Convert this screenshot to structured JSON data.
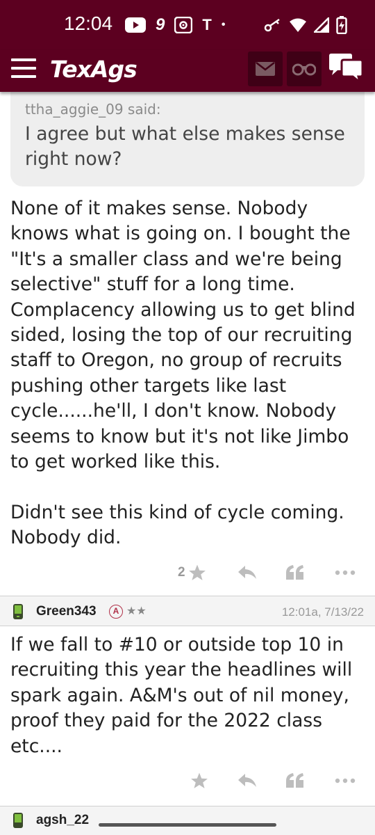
{
  "status_bar": {
    "time": "12:04",
    "icons": [
      "youtube-icon",
      "nine-icon",
      "radio-icon",
      "t-icon",
      "dot-icon"
    ],
    "right_icons": [
      "key-icon",
      "wifi-icon",
      "signal-icon",
      "battery-icon"
    ]
  },
  "nav": {
    "logo": "TexAgs",
    "brand_color": "#5c0020",
    "buttons": [
      "mail-icon",
      "binoculars-icon",
      "chat-icon"
    ]
  },
  "quote": {
    "author": "ttha_aggie_09 said:",
    "text": "I agree but what else makes sense right now?"
  },
  "post1": {
    "body": "None of it makes sense. Nobody knows what is going on. I bought the \"It's a smaller class and we're being selective\" stuff for a long time. Complacency allowing us to get blind sided, losing the top of our recruiting staff to Oregon, no group of recruits pushing other targets like last cycle......he'll, I don't know. Nobody seems to know but it's not like Jimbo to get worked like this.\n\nDidn't see this kind of cycle coming. Nobody did.",
    "star_count": "2"
  },
  "post2": {
    "username": "Green343",
    "badge": "A",
    "stars": "★★",
    "timestamp": "12:01a, 7/13/22",
    "body": "If we fall to #10 or outside top 10 in recruiting this year the headlines will spark again. A&M's out of nil money, proof they paid for the 2022 class etc...."
  },
  "post3": {
    "username_partial": "agsh_22"
  }
}
